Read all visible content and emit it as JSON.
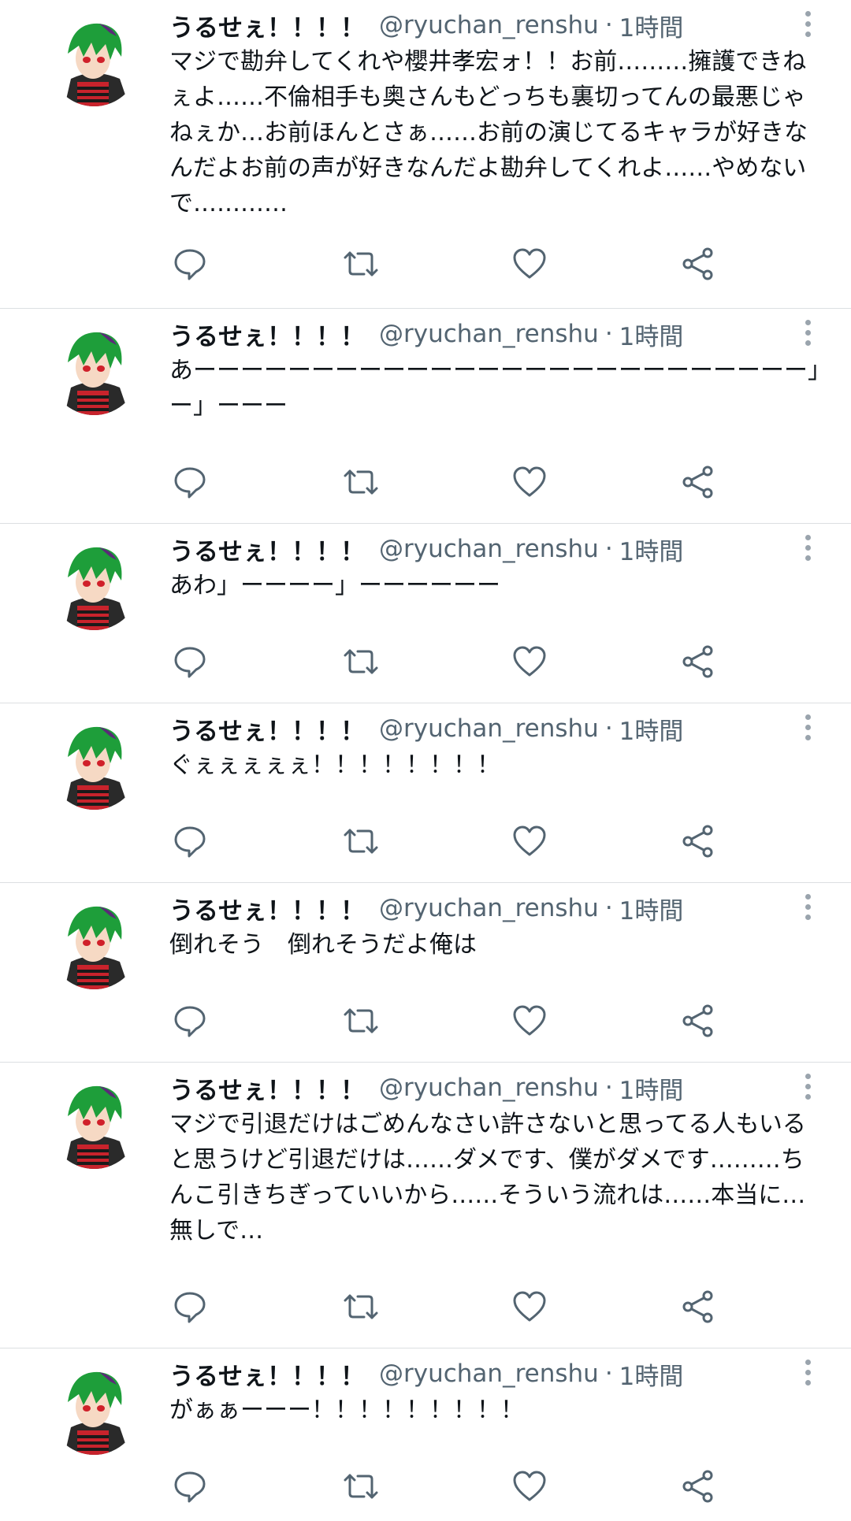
{
  "feed": {
    "tweets": [
      {
        "name": "うるせぇ！！！！",
        "handle": "@ryuchan_renshu",
        "dot": "·",
        "time": "1時間",
        "text": "マジで勘弁してくれや櫻井孝宏ォ！！お前………擁護できねぇよ……不倫相手も奥さんもどっちも裏切ってんの最悪じゃねぇか…お前ほんとさぁ……お前の演じてるキャラが好きなんだよお前の声が好きなんだよ勘弁してくれよ……やめないで…………"
      },
      {
        "name": "うるせぇ！！！！",
        "handle": "@ryuchan_renshu",
        "dot": "·",
        "time": "1時間",
        "text": "あーーーーーーーーーーーーーーーーーーーーーーーーーー」ー」ーーー"
      },
      {
        "name": "うるせぇ！！！！",
        "handle": "@ryuchan_renshu",
        "dot": "·",
        "time": "1時間",
        "text": "あわ」ーーーー」ーーーーーー"
      },
      {
        "name": "うるせぇ！！！！",
        "handle": "@ryuchan_renshu",
        "dot": "·",
        "time": "1時間",
        "text": "ぐぇぇぇぇぇ！！！！！！！！"
      },
      {
        "name": "うるせぇ！！！！",
        "handle": "@ryuchan_renshu",
        "dot": "·",
        "time": "1時間",
        "text": "倒れそう　倒れそうだよ俺は"
      },
      {
        "name": "うるせぇ！！！！",
        "handle": "@ryuchan_renshu",
        "dot": "·",
        "time": "1時間",
        "text": "マジで引退だけはごめんなさい許さないと思ってる人もいると思うけど引退だけは……ダメです、僕がダメです………ちんこ引きちぎっていいから……そういう流れは……本当に…無しで…"
      },
      {
        "name": "うるせぇ！！！！",
        "handle": "@ryuchan_renshu",
        "dot": "·",
        "time": "1時間",
        "text": "がぁぁーーー！！！！！！！！！"
      }
    ]
  },
  "icons": {
    "reply": "reply-icon",
    "retweet": "retweet-icon",
    "like": "heart-icon",
    "share": "share-icon",
    "more": "more-vertical-icon"
  },
  "colors": {
    "secondary_text": "#536471",
    "divider": "#dcdfe2",
    "avatar_hair": "#1e9e3a"
  }
}
